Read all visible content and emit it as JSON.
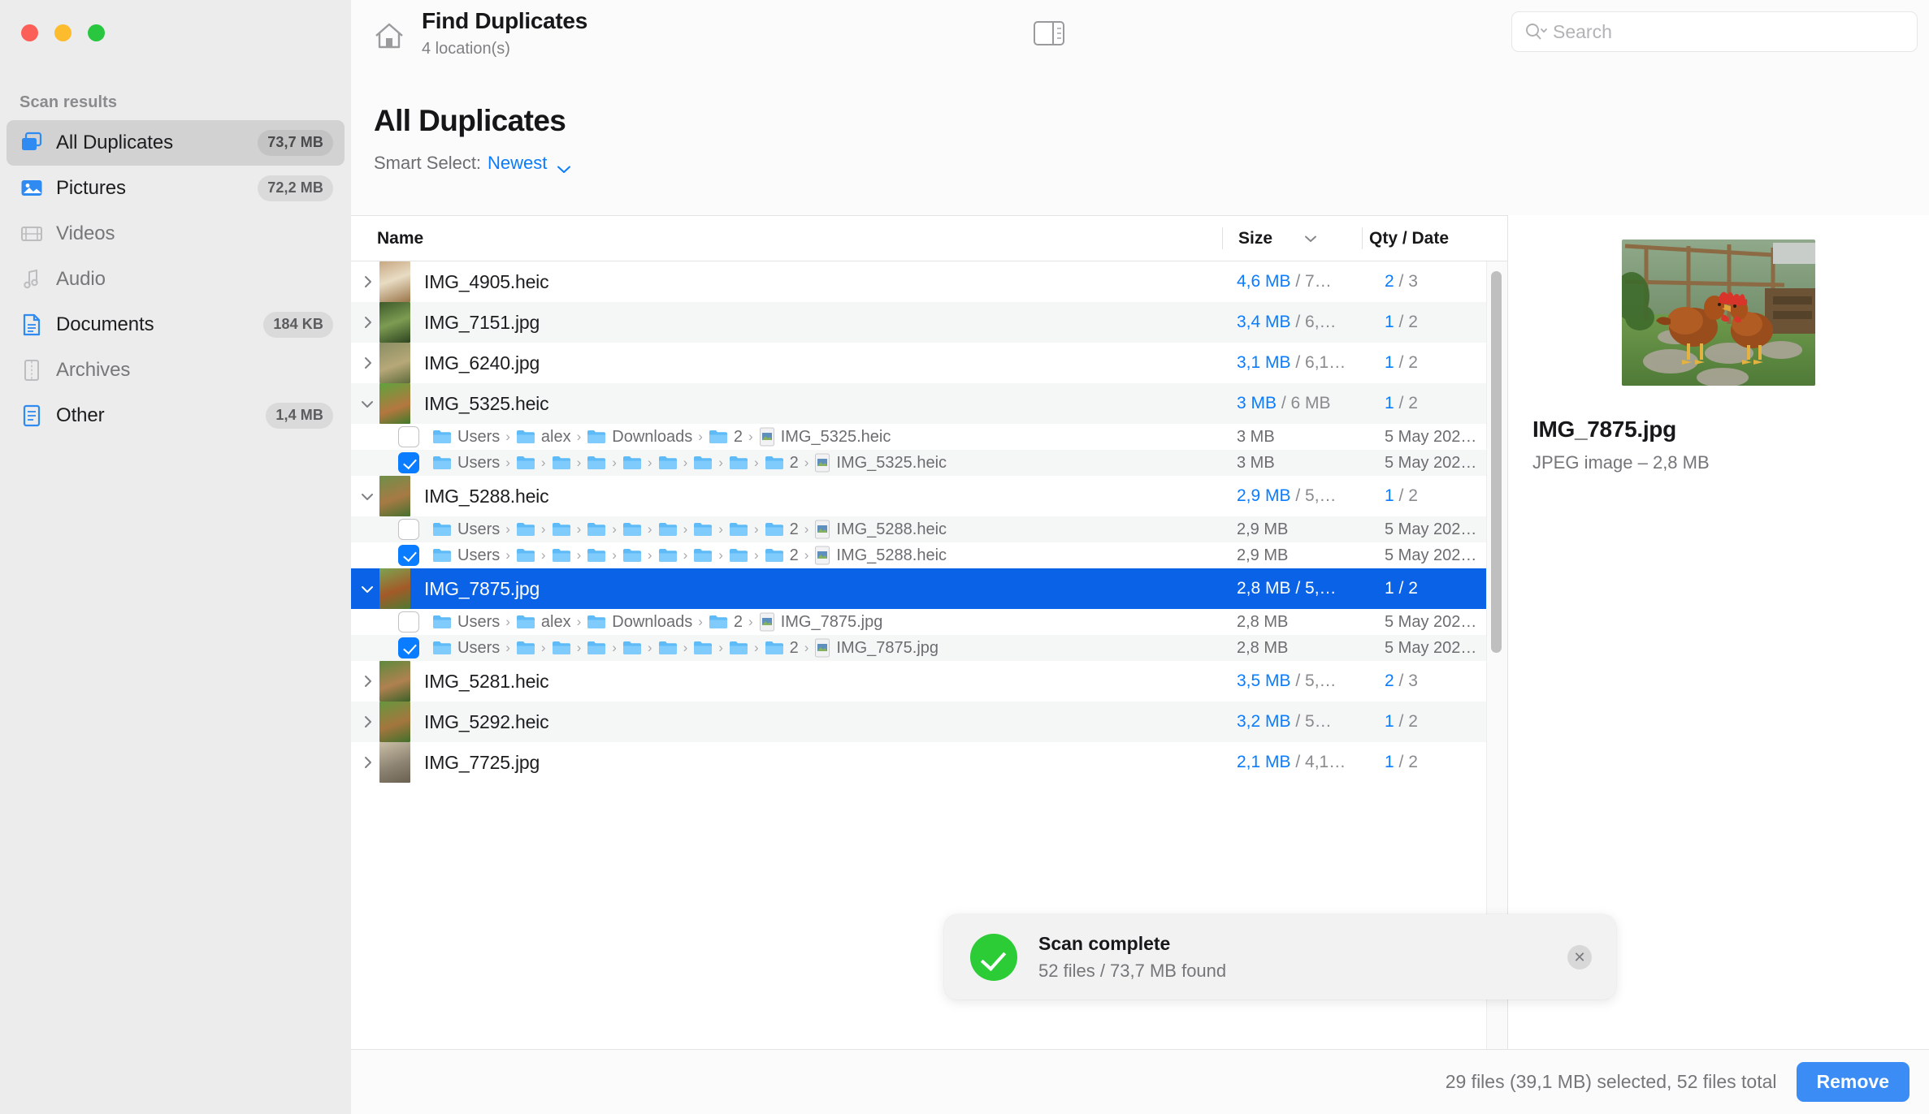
{
  "window": {
    "traffic_lights": [
      "close",
      "minimize",
      "zoom"
    ],
    "colors": {
      "accent": "#0a7cff",
      "selection": "#0a63e7",
      "success": "#2bcc36",
      "remove_button": "#3b8cf5"
    }
  },
  "sidebar": {
    "section_title": "Scan results",
    "items": [
      {
        "label": "All Duplicates",
        "badge": "73,7 MB",
        "icon": "duplicates-icon",
        "active": true,
        "dim": false
      },
      {
        "label": "Pictures",
        "badge": "72,2 MB",
        "icon": "pictures-icon",
        "active": false,
        "dim": false
      },
      {
        "label": "Videos",
        "badge": "",
        "icon": "videos-icon",
        "active": false,
        "dim": true
      },
      {
        "label": "Audio",
        "badge": "",
        "icon": "audio-icon",
        "active": false,
        "dim": true
      },
      {
        "label": "Documents",
        "badge": "184 KB",
        "icon": "documents-icon",
        "active": false,
        "dim": false
      },
      {
        "label": "Archives",
        "badge": "",
        "icon": "archives-icon",
        "active": false,
        "dim": true
      },
      {
        "label": "Other",
        "badge": "1,4 MB",
        "icon": "other-icon",
        "active": false,
        "dim": false
      }
    ]
  },
  "header": {
    "home_icon": "home-icon",
    "title": "Find Duplicates",
    "subtitle": "4 location(s)",
    "panel_toggle_icon": "sidebar-panel-toggle-icon",
    "search": {
      "icon": "search-icon",
      "placeholder": "Search",
      "value": ""
    }
  },
  "page": {
    "title": "All Duplicates",
    "smart_select_label": "Smart Select:",
    "smart_select_value": "Newest",
    "smart_select_chevron": "chevron-down-icon"
  },
  "table": {
    "columns": {
      "name": "Name",
      "size": "Size",
      "qty_date": "Qty / Date"
    },
    "sort_icon": "chevron-down-icon",
    "rows": [
      {
        "type": "parent",
        "name": "IMG_4905.heic",
        "expanded": false,
        "selected": false,
        "alt": false,
        "size_a": "4,6 MB",
        "size_b": " / 7…",
        "qty_a": "2",
        "qty_b": " / 3"
      },
      {
        "type": "parent",
        "name": "IMG_7151.jpg",
        "expanded": false,
        "selected": false,
        "alt": true,
        "size_a": "3,4 MB",
        "size_b": " / 6,…",
        "qty_a": "1",
        "qty_b": " / 2"
      },
      {
        "type": "parent",
        "name": "IMG_6240.jpg",
        "expanded": false,
        "selected": false,
        "alt": false,
        "size_a": "3,1 MB",
        "size_b": " / 6,1…",
        "qty_a": "1",
        "qty_b": " / 2"
      },
      {
        "type": "parent",
        "name": "IMG_5325.heic",
        "expanded": true,
        "selected": false,
        "alt": true,
        "size_a": "3 MB",
        "size_b": " / 6 MB",
        "qty_a": "1",
        "qty_b": " / 2"
      },
      {
        "type": "child",
        "checked": false,
        "alt": false,
        "path": [
          "Users",
          "alex",
          "Downloads",
          "2"
        ],
        "file": "IMG_5325.heic",
        "size": "3 MB",
        "date": "5 May 202…"
      },
      {
        "type": "child",
        "checked": true,
        "alt": true,
        "path": [
          "Users",
          "",
          "",
          "",
          "",
          "",
          "",
          "",
          "2"
        ],
        "file": "IMG_5325.heic",
        "size": "3 MB",
        "date": "5 May 202…"
      },
      {
        "type": "parent",
        "name": "IMG_5288.heic",
        "expanded": true,
        "selected": false,
        "alt": false,
        "size_a": "2,9 MB",
        "size_b": " / 5,…",
        "qty_a": "1",
        "qty_b": " / 2"
      },
      {
        "type": "child",
        "checked": false,
        "alt": true,
        "path": [
          "Users",
          "",
          "",
          "",
          "",
          "",
          "",
          "",
          "2"
        ],
        "file": "IMG_5288.heic",
        "size": "2,9 MB",
        "date": "5 May 202…"
      },
      {
        "type": "child",
        "checked": true,
        "alt": false,
        "path": [
          "Users",
          "",
          "",
          "",
          "",
          "",
          "",
          "",
          "2"
        ],
        "file": "IMG_5288.heic",
        "size": "2,9 MB",
        "date": "5 May 202…"
      },
      {
        "type": "parent",
        "name": "IMG_7875.jpg",
        "expanded": true,
        "selected": true,
        "alt": false,
        "size_a": "2,8 MB",
        "size_b": " / 5,…",
        "qty_a": "1",
        "qty_b": " / 2"
      },
      {
        "type": "child",
        "checked": false,
        "alt": false,
        "path": [
          "Users",
          "alex",
          "Downloads",
          "2"
        ],
        "file": "IMG_7875.jpg",
        "size": "2,8 MB",
        "date": "5 May 202…"
      },
      {
        "type": "child",
        "checked": true,
        "alt": true,
        "path": [
          "Users",
          "",
          "",
          "",
          "",
          "",
          "",
          "",
          "2"
        ],
        "file": "IMG_7875.jpg",
        "size": "2,8 MB",
        "date": "5 May 202…"
      },
      {
        "type": "parent",
        "name": "IMG_5281.heic",
        "expanded": false,
        "selected": false,
        "alt": false,
        "size_a": "3,5 MB",
        "size_b": " / 5,…",
        "qty_a": "2",
        "qty_b": " / 3"
      },
      {
        "type": "parent",
        "name": "IMG_5292.heic",
        "expanded": false,
        "selected": false,
        "alt": true,
        "size_a": "3,2 MB",
        "size_b": " / 5…",
        "qty_a": "1",
        "qty_b": " / 2"
      },
      {
        "type": "parent",
        "name": "IMG_7725.jpg",
        "expanded": false,
        "selected": false,
        "alt": false,
        "size_a": "2,1 MB",
        "size_b": " / 4,1…",
        "qty_a": "1",
        "qty_b": " / 2"
      }
    ]
  },
  "preview": {
    "image_alt": "two brown chickens in a fenced coop on grass and stepping stones",
    "name": "IMG_7875.jpg",
    "meta": "JPEG image – 2,8 MB"
  },
  "toast": {
    "icon": "success-check-icon",
    "title": "Scan complete",
    "subtitle": "52 files / 73,7 MB found",
    "close_icon": "close-icon",
    "close_glyph": "✕"
  },
  "footer": {
    "status": "29 files (39,1 MB) selected, 52 files total",
    "remove_label": "Remove"
  }
}
